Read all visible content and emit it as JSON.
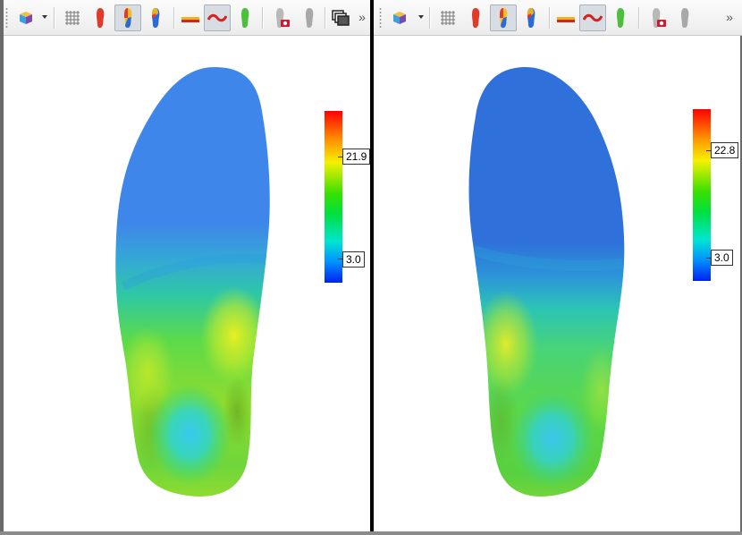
{
  "left_view": {
    "scale": {
      "max_label": "21.9",
      "min_label": "3.0"
    }
  },
  "right_view": {
    "scale": {
      "max_label": "22.8",
      "min_label": "3.0"
    }
  },
  "toolbar": {
    "overflow_glyph": "»",
    "icons": [
      "3d-cube-icon",
      "grid-icon",
      "red-foot-icon",
      "pressure-map-foot-icon",
      "half-color-foot-icon",
      "profile-line-icon",
      "wave-curve-icon",
      "green-foot-icon",
      "foot-camera-icon",
      "gray-foot-icon",
      "window-stack-icon"
    ],
    "active_tools": [
      "pressure-map",
      "wave-curve"
    ]
  },
  "colors": {
    "scale_top": "#ff0000",
    "scale_bottom": "#0022ee",
    "forefoot_blue": "#3d84e8",
    "divider": "#000000"
  }
}
